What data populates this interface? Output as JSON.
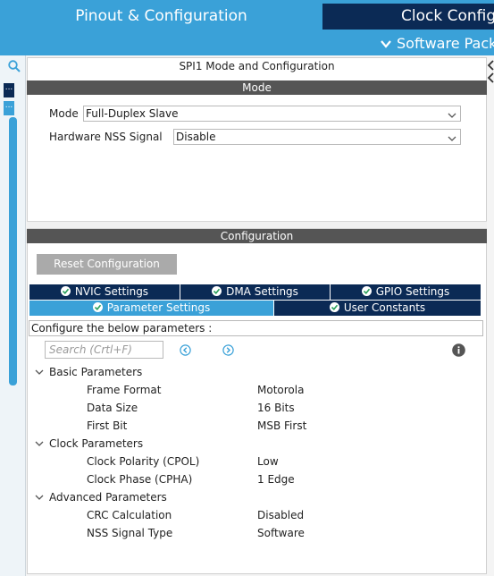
{
  "top_tabs": {
    "pinout": "Pinout & Configuration",
    "clock": "Clock Configuration",
    "software_packs": "Software Packs"
  },
  "left_strip": {
    "search_icon": "search-icon",
    "mini1": "...",
    "mini2": "..."
  },
  "panel": {
    "title": "SPI1 Mode and Configuration",
    "mode_section": "Mode",
    "mode_label": "Mode",
    "mode_value": "Full-Duplex Slave",
    "nss_label": "Hardware NSS Signal",
    "nss_value": "Disable",
    "config_section": "Configuration",
    "reset_button": "Reset Configuration"
  },
  "tabs": {
    "nvic": "NVIC Settings",
    "dma": "DMA Settings",
    "gpio": "GPIO Settings",
    "parameter": "Parameter Settings",
    "user_constants": "User Constants"
  },
  "params": {
    "hint": "Configure the below parameters :",
    "search_placeholder": "Search (Crtl+F)",
    "groups": [
      {
        "name": "Basic Parameters",
        "items": [
          {
            "name": "Frame Format",
            "value": "Motorola"
          },
          {
            "name": "Data Size",
            "value": "16 Bits"
          },
          {
            "name": "First Bit",
            "value": "MSB First"
          }
        ]
      },
      {
        "name": "Clock Parameters",
        "items": [
          {
            "name": "Clock Polarity (CPOL)",
            "value": "Low"
          },
          {
            "name": "Clock Phase (CPHA)",
            "value": "1 Edge"
          }
        ]
      },
      {
        "name": "Advanced Parameters",
        "items": [
          {
            "name": "CRC Calculation",
            "value": "Disabled"
          },
          {
            "name": "NSS Signal Type",
            "value": "Software"
          }
        ]
      }
    ]
  },
  "colors": {
    "accent": "#3aa1d8",
    "dark": "#0b2a55",
    "section": "#555555",
    "button": "#aaaaaa"
  }
}
